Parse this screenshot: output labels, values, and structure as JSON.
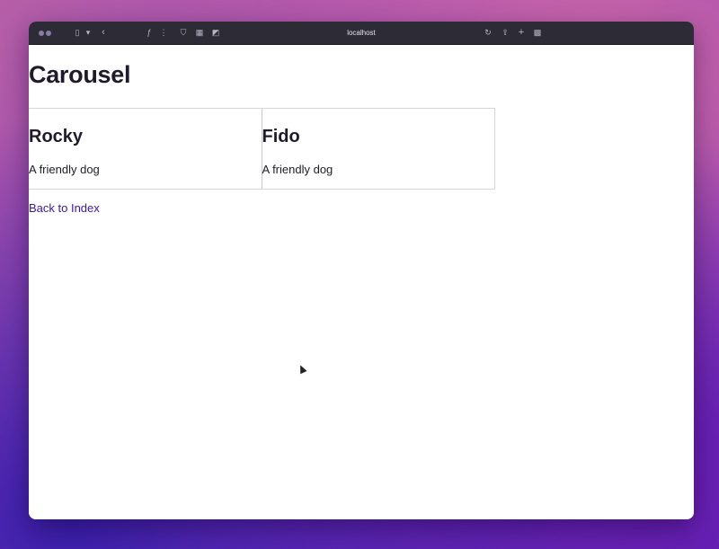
{
  "browser": {
    "url": "localhost",
    "icons": [
      "traffic-lights",
      "sidebar-icon",
      "chevron-down-icon",
      "back-icon",
      "extension-icon",
      "more-icon",
      "shield-icon",
      "grid-icon",
      "tab-icon",
      "reload-icon",
      "share-icon",
      "new-tab-icon",
      "tab-overview-icon"
    ]
  },
  "page": {
    "title": "Carousel",
    "cards": [
      {
        "name": "Rocky",
        "description": "A friendly dog"
      },
      {
        "name": "Fido",
        "description": "A friendly dog"
      }
    ],
    "back_link": "Back to Index"
  },
  "colors": {
    "link": "#3a16a8",
    "titlebar": "#2d2b36",
    "text": "#1f1b2a"
  }
}
